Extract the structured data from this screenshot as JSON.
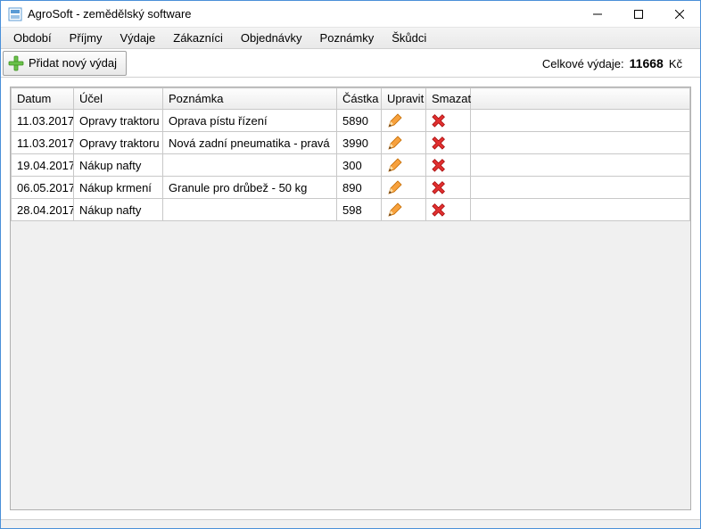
{
  "window": {
    "title": "AgroSoft - zemědělský software"
  },
  "menu": {
    "items": [
      "Období",
      "Příjmy",
      "Výdaje",
      "Zákazníci",
      "Objednávky",
      "Poznámky",
      "Škůdci"
    ]
  },
  "toolbar": {
    "add_label": "Přidat nový výdaj"
  },
  "total": {
    "label": "Celkové výdaje:",
    "value": "11668",
    "currency": "Kč"
  },
  "table": {
    "headers": {
      "date": "Datum",
      "purpose": "Účel",
      "note": "Poznámka",
      "amount": "Částka",
      "edit": "Upravit",
      "delete": "Smazat"
    },
    "rows": [
      {
        "date": "11.03.2017",
        "purpose": "Opravy traktoru",
        "note": "Oprava pístu řízení",
        "amount": "5890"
      },
      {
        "date": "11.03.2017",
        "purpose": "Opravy traktoru",
        "note": "Nová zadní pneumatika - pravá",
        "amount": "3990"
      },
      {
        "date": "19.04.2017",
        "purpose": "Nákup nafty",
        "note": "",
        "amount": "300"
      },
      {
        "date": "06.05.2017",
        "purpose": "Nákup krmení",
        "note": "Granule pro drůbež - 50 kg",
        "amount": "890"
      },
      {
        "date": "28.04.2017",
        "purpose": "Nákup nafty",
        "note": "",
        "amount": "598"
      }
    ]
  }
}
